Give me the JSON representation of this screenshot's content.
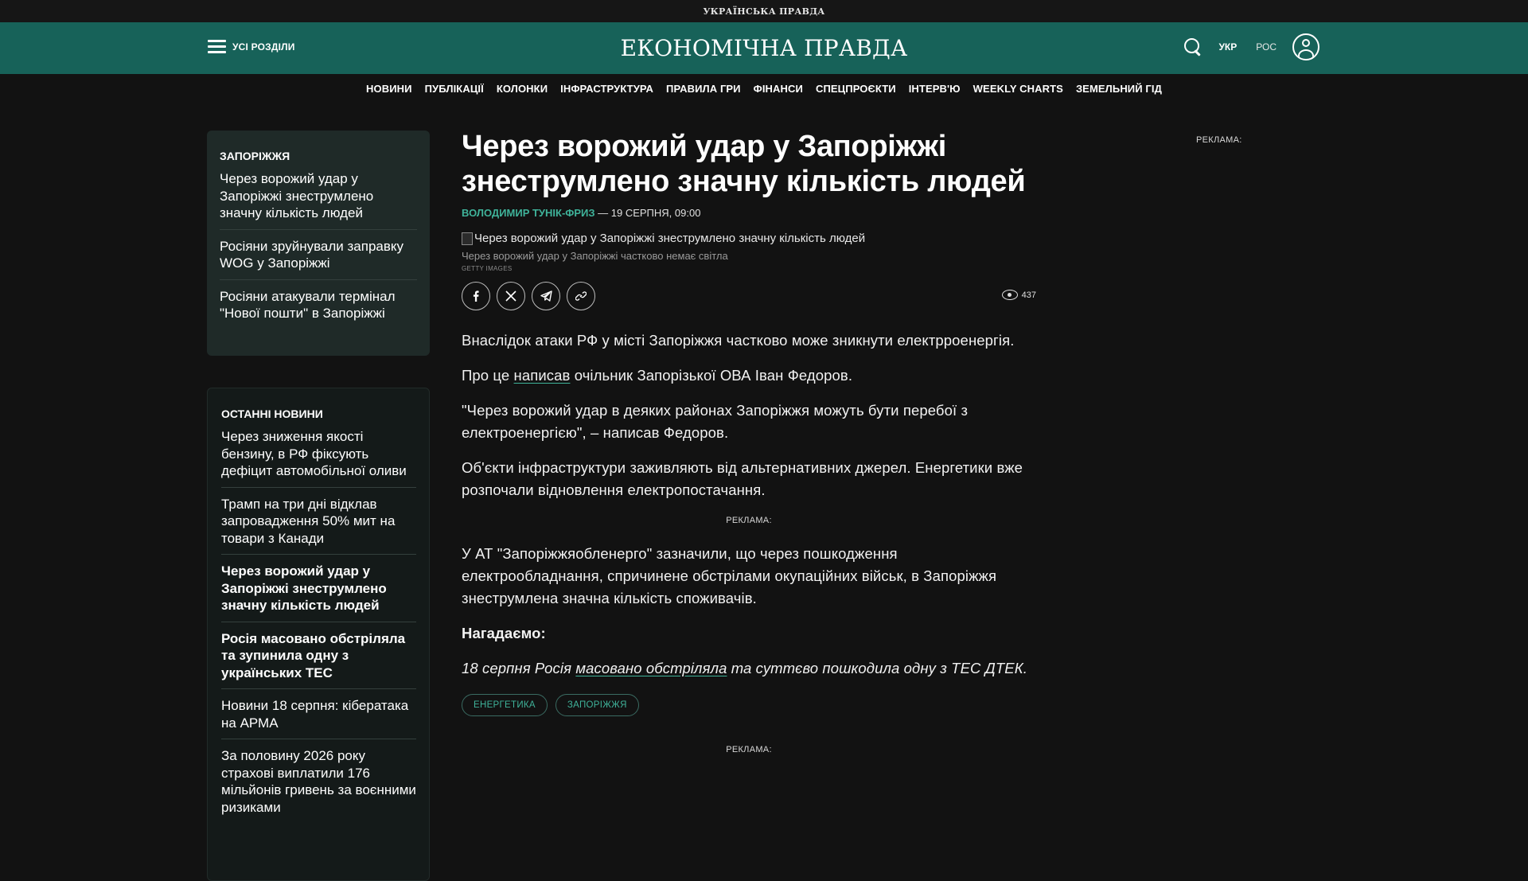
{
  "top_strip": {
    "brand": "УКРАЇНСЬКА ПРАВДА"
  },
  "header": {
    "menu_label": "УСІ РОЗДІЛИ",
    "logo": "ЕКОНОМІЧНА ПРАВДА",
    "lang_ukr": "УКР",
    "lang_ros": "РОС"
  },
  "nav": [
    "НОВИНИ",
    "ПУБЛІКАЦІЇ",
    "КОЛОНКИ",
    "ІНФРАСТРУКТУРА",
    "ПРАВИЛА ГРИ",
    "ФІНАНСИ",
    "СПЕЦПРОЄКТИ",
    "ІНТЕРВ'Ю",
    "WEEKLY CHARTS",
    "ЗЕМЕЛЬНИЙ ГІД"
  ],
  "sidebar_region": {
    "title": "ЗАПОРІЖЖЯ",
    "items": [
      "Через ворожий удар у Запоріжжі знеструмлено значну кількість людей",
      "Росіяни зруйнували заправку WOG у Запоріжжі",
      "Росіяни атакували термінал \"Нової пошти\" в Запоріжжі"
    ]
  },
  "sidebar_latest": {
    "title": "ОСТАННІ НОВИНИ",
    "items": [
      {
        "text": "Через зниження якості бензину, в РФ фіксують дефіцит автомобільної оливи",
        "bold": false
      },
      {
        "text": "Трамп на три дні відклав запровадження 50% мит на товари з Канади",
        "bold": false
      },
      {
        "text": "Через ворожий удар у Запоріжжі знеструмлено значну кількість людей",
        "bold": true
      },
      {
        "text": "Росія масовано обстріляла та зупинила одну з українських ТЕС",
        "bold": true
      },
      {
        "text": "Новини 18 серпня: кібератака на АРМА",
        "bold": false
      },
      {
        "text": "За половину 2026 року страхові виплатили 176 мільйонів гривень за воєнними ризиками",
        "bold": false
      }
    ]
  },
  "article": {
    "title": "Через ворожий удар у Запоріжжі знеструмлено значну кількість людей",
    "author": "ВОЛОДИМИР ТУНІК-ФРИЗ",
    "date": " — 19 СЕРПНЯ, 09:00",
    "image_alt": "Через ворожий удар у Запоріжжі знеструмлено значну кількість людей",
    "caption": "Через ворожий удар у Запоріжжі частково немає світла",
    "credit": "GETTY IMAGES",
    "views": "437",
    "p1": "Внаслідок атаки РФ у місті Запоріжжя частково може зникнути електрроенергія.",
    "p2_before": "Про це ",
    "p2_link": "написав",
    "p2_after": " очільник Запорізької ОВА Іван Федоров.",
    "p3": "\"Через ворожий удар в деяких районах Запоріжжя можуть бути перебої з електроенергією\", – написав Федоров.",
    "p4": "Об'єкти інфраструктури заживляють від альтернативних джерел. Енергетики вже розпочали відновлення електропостачання.",
    "ad_label": "РЕКЛАМА:",
    "p5": "У АТ \"Запоріжжяобленерго\" зазначили, що через пошкодження електрообладнання, спричинене обстрілами окупаційних військ, в Запоріжжя знеструмлена значна кількість споживачів.",
    "reminder": "Нагадаємо:",
    "p6_before": "18 серпня Росія ",
    "p6_link": "масовано обстріляла",
    "p6_after": " та суттєво пошкодила одну з ТЕС ДТЕК.",
    "tags": [
      "ЕНЕРГЕТИКА",
      "ЗАПОРІЖЖЯ"
    ]
  },
  "side_ad_label": "РЕКЛАМА:",
  "colors": {
    "header_bg": "#176259",
    "accent": "#3fb39a",
    "page_bg": "#121212"
  }
}
